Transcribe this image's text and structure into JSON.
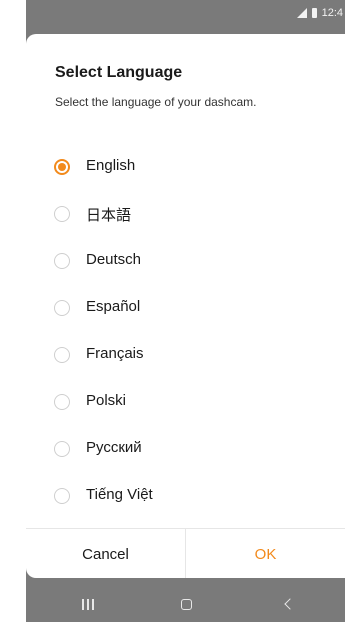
{
  "status_bar": {
    "time": "12:4",
    "icons": [
      "signal-icon",
      "battery-icon"
    ]
  },
  "dialog": {
    "title": "Select Language",
    "subtitle": "Select the language of your dashcam.",
    "options": [
      {
        "label": "English",
        "selected": true
      },
      {
        "label": "日本語",
        "selected": false
      },
      {
        "label": "Deutsch",
        "selected": false
      },
      {
        "label": "Español",
        "selected": false
      },
      {
        "label": "Français",
        "selected": false
      },
      {
        "label": "Polski",
        "selected": false
      },
      {
        "label": "Русский",
        "selected": false
      },
      {
        "label": "Tiếng Việt",
        "selected": false
      }
    ],
    "cancel_label": "Cancel",
    "ok_label": "OK"
  },
  "nav_bar": {
    "icons": [
      "recents-icon",
      "home-icon",
      "back-icon"
    ]
  },
  "colors": {
    "accent": "#f28a1c",
    "backdrop": "#7a7a7a"
  }
}
